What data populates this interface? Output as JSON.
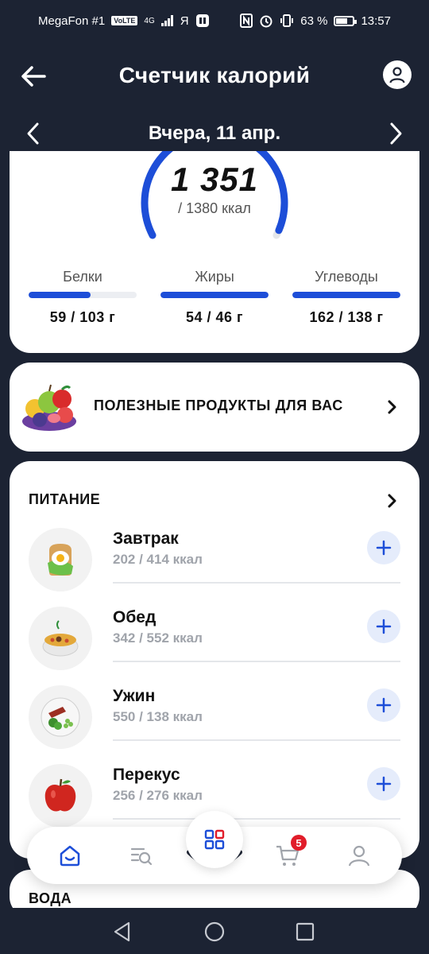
{
  "status_bar": {
    "carrier": "MegaFon #1",
    "volte": "VoLTE",
    "network": "4G",
    "extra": "Я",
    "battery": "63 %",
    "time": "13:57"
  },
  "header": {
    "title": "Счетчик калорий"
  },
  "date_nav": {
    "label": "Вчера, 11 апр."
  },
  "summary": {
    "kcal_consumed": "1 351",
    "kcal_target": "/ 1380 ккал",
    "gauge_fraction": 0.98,
    "macros": [
      {
        "label": "Белки",
        "value": "59 / 103 г",
        "fraction": 0.57
      },
      {
        "label": "Жиры",
        "value": "54 / 46 г",
        "fraction": 1.0
      },
      {
        "label": "Углеводы",
        "value": "162 / 138 г",
        "fraction": 1.0
      }
    ]
  },
  "products": {
    "label": "ПОЛЕЗНЫЕ ПРОДУКТЫ ДЛЯ ВАС"
  },
  "nutrition": {
    "title": "ПИТАНИЕ",
    "meals": [
      {
        "name": "Завтрак",
        "kcal": "202 / 414 ккал",
        "icon": "egg-toast-icon"
      },
      {
        "name": "Обед",
        "kcal": "342 / 552 ккал",
        "icon": "soup-bowl-icon"
      },
      {
        "name": "Ужин",
        "kcal": "550 / 138 ккал",
        "icon": "dinner-plate-icon"
      },
      {
        "name": "Перекус",
        "kcal": "256 / 276 ккал",
        "icon": "apple-icon"
      }
    ]
  },
  "water": {
    "title": "ВОДА"
  },
  "tabbar": {
    "cart_badge": "5",
    "tabs": [
      "home-icon",
      "search-list-icon",
      "grid-icon",
      "cart-icon",
      "profile-icon"
    ]
  },
  "colors": {
    "background": "#1c2333",
    "accent": "#1d4ed8",
    "badge": "#e11d2a"
  }
}
